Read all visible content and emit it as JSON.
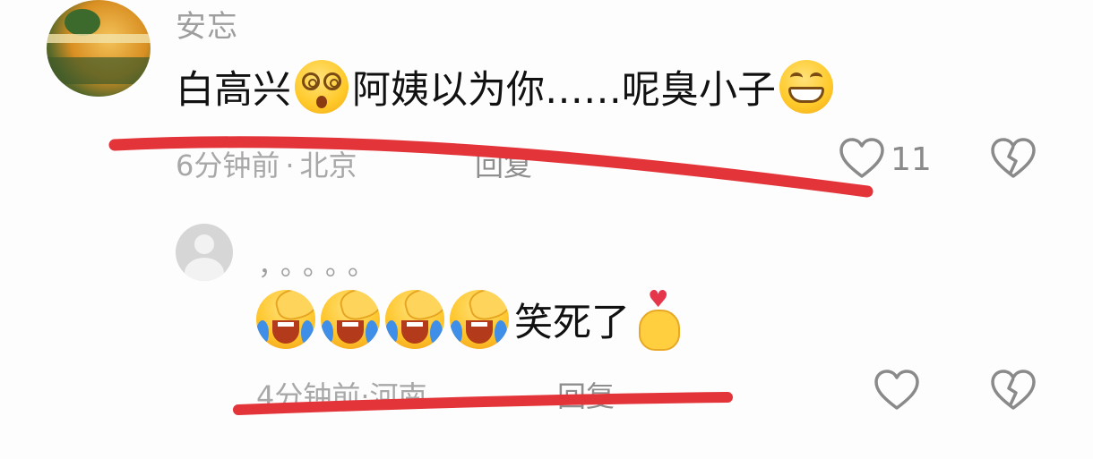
{
  "comment": {
    "username": "安忘",
    "text_parts": [
      "白高兴",
      "阿姨以为你……呢臭小子"
    ],
    "time": "6分钟前",
    "separator": "·",
    "location": "北京",
    "reply_label": "回复",
    "like_count": "11"
  },
  "reply": {
    "username": "，。。。。",
    "text": "笑死了",
    "time": "4分钟前",
    "separator": "·",
    "location": "河南",
    "reply_label": "回复"
  },
  "icons": {
    "like": "heart-outline-icon",
    "dislike": "broken-heart-icon",
    "avatar_placeholder": "default-avatar-icon"
  },
  "colors": {
    "text_primary": "#111111",
    "text_secondary": "#a8a8a8",
    "icon_gray": "#8a8a8a",
    "annotation_red": "#e3343a"
  }
}
